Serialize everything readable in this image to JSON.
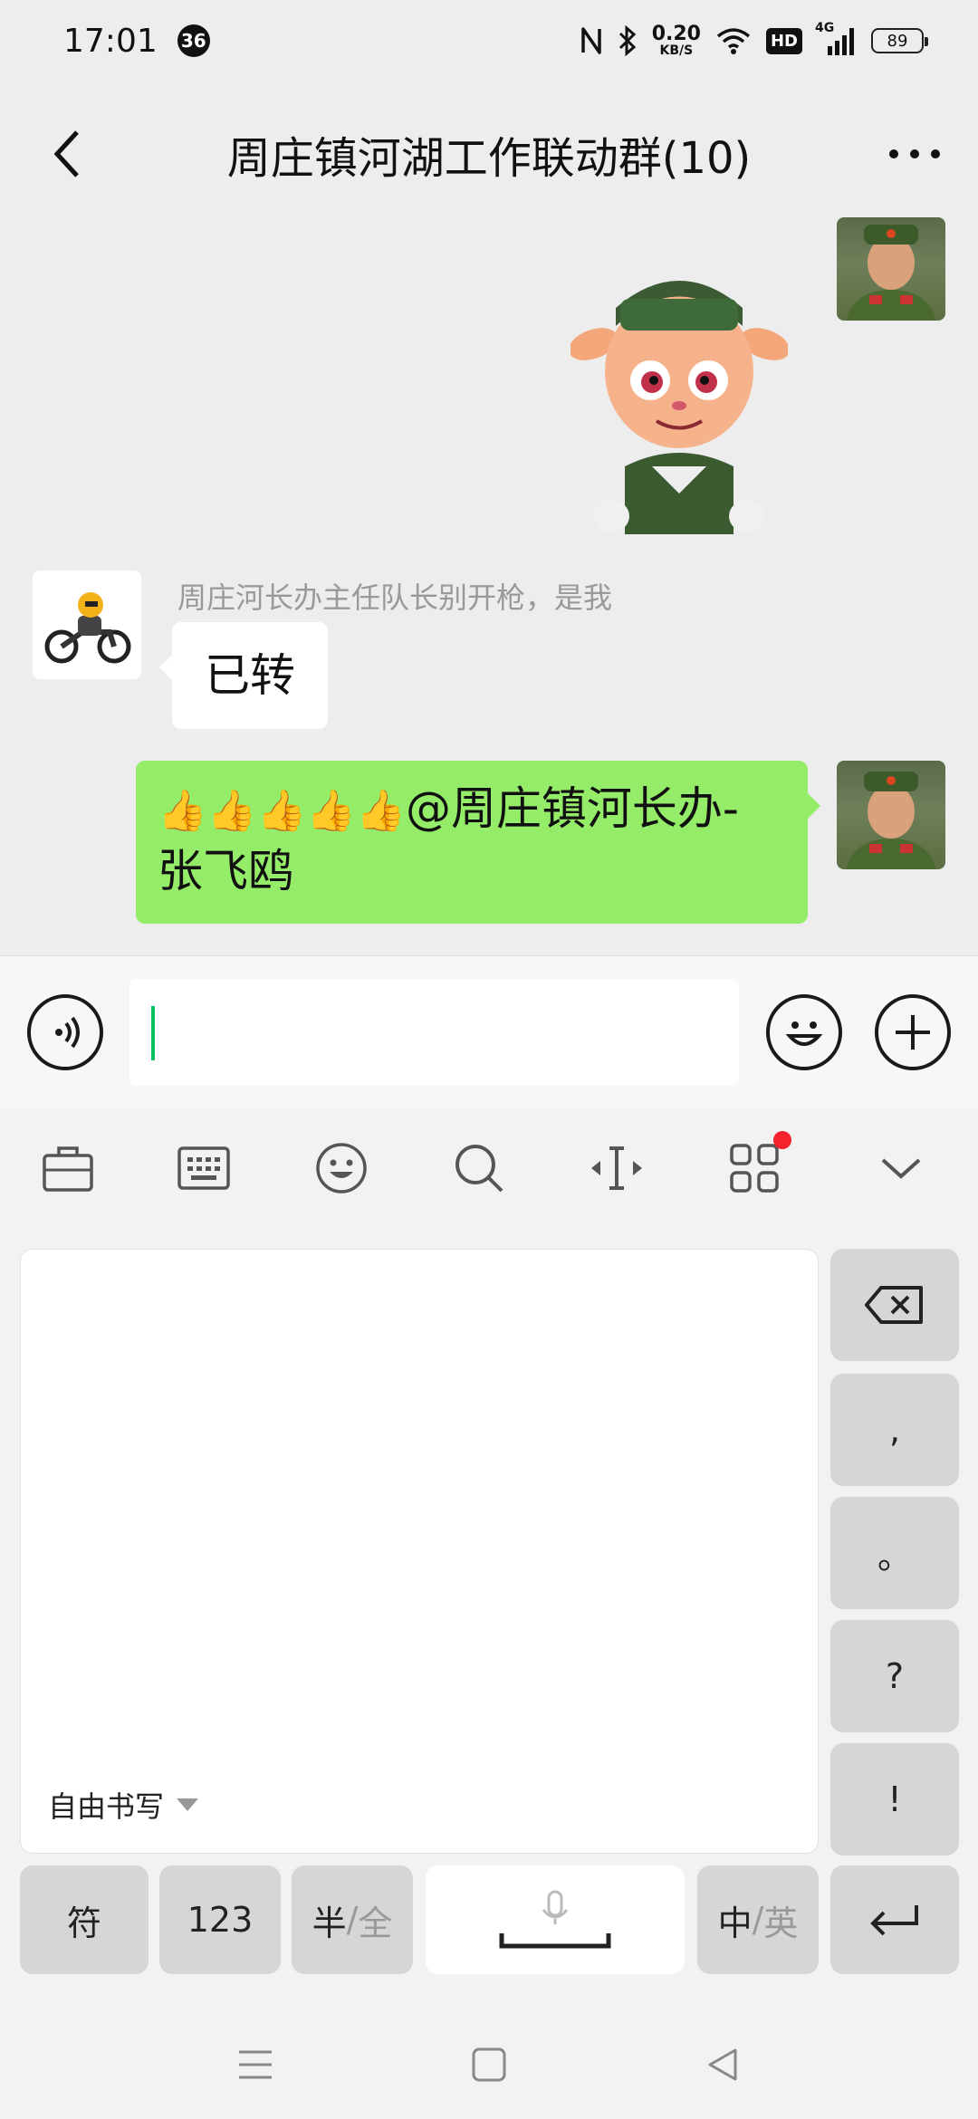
{
  "status_bar": {
    "time": "17:01",
    "notification_count": "36",
    "net_speed_value": "0.20",
    "net_speed_unit": "KB/S",
    "hd_label": "HD",
    "network_type": "4G",
    "battery": "89"
  },
  "header": {
    "title": "周庄镇河湖工作联动群(10)"
  },
  "messages": [
    {
      "type": "sticker",
      "side": "right"
    },
    {
      "type": "text",
      "side": "left",
      "sender": "周庄河长办主任队长别开枪，是我",
      "text": "已转"
    },
    {
      "type": "text",
      "side": "right",
      "emoji": "👍👍👍👍👍",
      "text_line1": "@周庄镇河长办-",
      "text_line2": "张飞鸥"
    }
  ],
  "keyboard": {
    "handwriting_mode_label": "自由书写",
    "punctuation_keys": [
      ",",
      "。",
      "?",
      "!"
    ],
    "bottom_row": {
      "symbol": "符",
      "numbers": "123",
      "half_width": "半",
      "full_width": "全",
      "zh": "中",
      "en": "英",
      "separator": "/"
    }
  }
}
